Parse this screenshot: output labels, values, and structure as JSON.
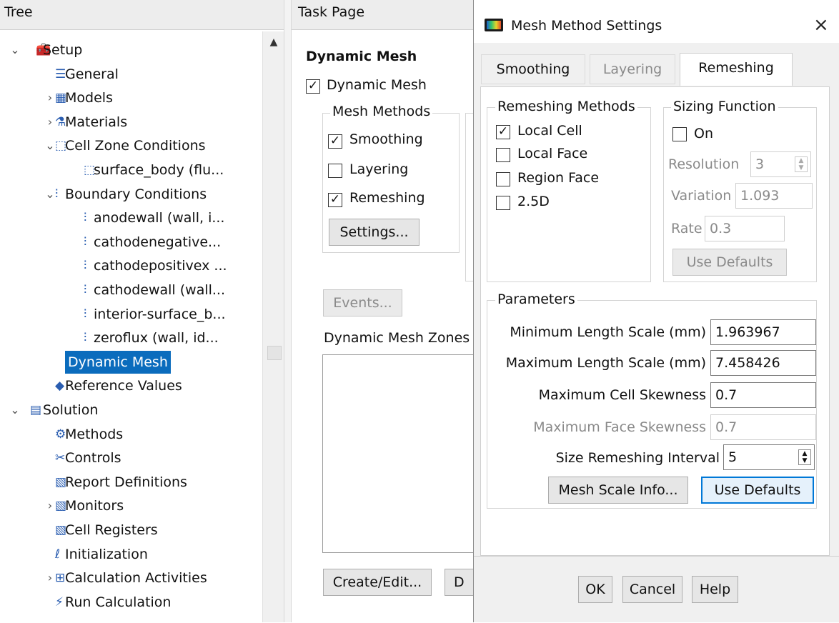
{
  "tree": {
    "header": "Tree",
    "items": [
      {
        "label": "Setup",
        "expander": "⌄",
        "icon": "setup-icon"
      },
      {
        "label": "General",
        "icon": "general-icon"
      },
      {
        "label": "Models",
        "expander": "›",
        "icon": "models-icon"
      },
      {
        "label": "Materials",
        "expander": "›",
        "icon": "materials-icon"
      },
      {
        "label": "Cell Zone Conditions",
        "expander": "⌄",
        "icon": "cell-zone-icon"
      },
      {
        "label": "surface_body (flu...",
        "icon": "cell-zone-icon"
      },
      {
        "label": "Boundary Conditions",
        "expander": "⌄",
        "icon": "boundary-icon"
      },
      {
        "label": "anodewall (wall, i...",
        "icon": "boundary-icon"
      },
      {
        "label": "cathodenegative...",
        "icon": "boundary-icon"
      },
      {
        "label": "cathodepositivex ...",
        "icon": "boundary-icon"
      },
      {
        "label": "cathodewall (wall...",
        "icon": "boundary-icon"
      },
      {
        "label": "interior-surface_b...",
        "icon": "boundary-icon"
      },
      {
        "label": "zeroflux (wall, id...",
        "icon": "boundary-icon"
      },
      {
        "label": "Dynamic Mesh",
        "icon": "dynamic-mesh-icon",
        "selected": true
      },
      {
        "label": "Reference Values",
        "icon": "reference-icon"
      },
      {
        "label": "Solution",
        "expander": "⌄",
        "icon": "solution-icon"
      },
      {
        "label": "Methods",
        "icon": "methods-icon"
      },
      {
        "label": "Controls",
        "icon": "controls-icon"
      },
      {
        "label": "Report Definitions",
        "icon": "report-icon"
      },
      {
        "label": "Monitors",
        "expander": "›",
        "icon": "report-icon"
      },
      {
        "label": "Cell Registers",
        "icon": "report-icon"
      },
      {
        "label": "Initialization",
        "icon": "initialization-icon"
      },
      {
        "label": "Calculation Activities",
        "expander": "›",
        "icon": "calc-activities-icon"
      },
      {
        "label": "Run Calculation",
        "icon": "run-icon"
      }
    ]
  },
  "task": {
    "header": "Task Page",
    "title": "Dynamic Mesh",
    "dynamic_mesh_label": "Dynamic Mesh",
    "mesh_methods_group": "Mesh Methods",
    "smoothing_label": "Smoothing",
    "layering_label": "Layering",
    "remeshing_label": "Remeshing",
    "settings_button": "Settings...",
    "events_button": "Events...",
    "zones_label": "Dynamic Mesh Zones",
    "create_edit_button": "Create/Edit...",
    "delete_button_partial": "D"
  },
  "dialog": {
    "title": "Mesh Method Settings",
    "close": "×",
    "tabs": [
      "Smoothing",
      "Layering",
      "Remeshing"
    ],
    "active_tab": "Remeshing",
    "remeshing_methods": {
      "label": "Remeshing Methods",
      "options": [
        {
          "label": "Local Cell",
          "checked": true
        },
        {
          "label": "Local Face",
          "checked": false
        },
        {
          "label": "Region Face",
          "checked": false
        },
        {
          "label": "2.5D",
          "checked": false
        }
      ]
    },
    "sizing_function": {
      "label": "Sizing Function",
      "on_label": "On",
      "resolution_label": "Resolution",
      "resolution_value": "3",
      "variation_label": "Variation",
      "variation_value": "1.093",
      "rate_label": "Rate",
      "rate_value": "0.3",
      "use_defaults": "Use Defaults"
    },
    "parameters": {
      "label": "Parameters",
      "min_length_label": "Minimum Length Scale (mm)",
      "min_length_value": "1.963967",
      "max_length_label": "Maximum Length Scale (mm)",
      "max_length_value": "7.458426",
      "max_cell_skew_label": "Maximum Cell Skewness",
      "max_cell_skew_value": "0.7",
      "max_face_skew_label": "Maximum Face Skewness",
      "max_face_skew_value": "0.7",
      "interval_label": "Size Remeshing Interval",
      "interval_value": "5",
      "mesh_scale_button": "Mesh Scale Info...",
      "use_defaults_button": "Use Defaults"
    },
    "ok": "OK",
    "cancel": "Cancel",
    "help": "Help"
  },
  "colors": {
    "selection": "#0b6cbd",
    "focus_border": "#0078d7"
  }
}
